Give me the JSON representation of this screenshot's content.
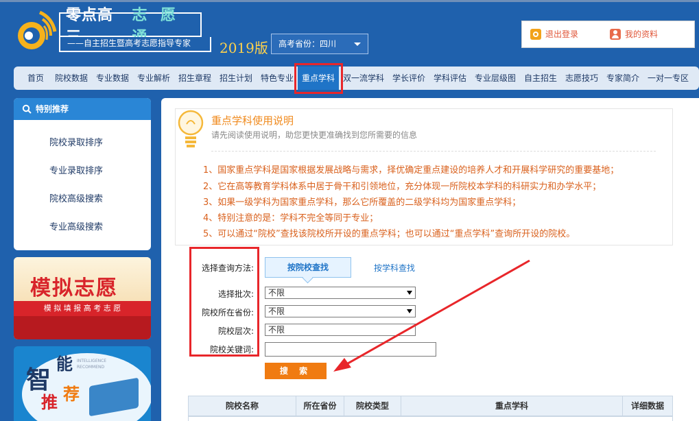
{
  "header": {
    "brand_main": "零点高三",
    "brand_accent": "志 愿 通",
    "brand_sub": "——自主招生暨高考志愿指导专家",
    "year": "2019版",
    "province_select": "高考省份：四川",
    "logout": "退出登录",
    "profile": "我的资料"
  },
  "nav": {
    "items": [
      "首页",
      "院校数据",
      "专业数据",
      "专业解析",
      "招生章程",
      "招生计划",
      "特色专业",
      "重点学科",
      "双一流学科",
      "学长评价",
      "学科评估",
      "专业层级图",
      "自主招生",
      "志愿技巧",
      "专家简介",
      "一对一专区"
    ],
    "active": "重点学科"
  },
  "sidebar": {
    "header": "特别推荐",
    "links": [
      "院校录取排序",
      "专业录取排序",
      "院校高级搜索",
      "专业高级搜索"
    ]
  },
  "banners": {
    "mock_title": "模拟志愿",
    "mock_sub": "模 拟 填 报 高 考 志 愿",
    "smart_title_1": "智",
    "smart_title_2": "能",
    "smart_title_3": "推",
    "smart_title_4": "荐",
    "smart_en_1": "INTELLIGENCE",
    "smart_en_2": "RECOMMEND"
  },
  "info": {
    "title": "重点学科使用说明",
    "subtitle": "请先阅读使用说明，助您更快更准确找到您所需要的信息",
    "rules": [
      "1、国家重点学科是国家根据发展战略与需求，择优确定重点建设的培养人才和开展科学研究的重要基地；",
      "2、它在高等教育学科体系中居于骨干和引领地位，充分体现一所院校本学科的科研实力和办学水平；",
      "3、如果一级学科为国家重点学科，那么它所覆盖的二级学科均为国家重点学科；",
      "4、特别注意的是：学科不完全等同于专业；",
      "5、可以通过“院校”查找该院校所开设的重点学科；也可以通过“重点学科”查询所开设的院校。"
    ]
  },
  "search": {
    "method_label": "选择查询方法:",
    "tab_by_school": "按院校查找",
    "tab_by_subject": "按学科查找",
    "batch_label": "选择批次:",
    "batch_value": "不限",
    "province_label": "院校所在省份:",
    "province_value": "不限",
    "level_label": "院校层次:",
    "level_value": "不限",
    "keyword_label": "院校关键词:",
    "keyword_value": "",
    "submit": "搜 索"
  },
  "table": {
    "columns": [
      "院校名称",
      "所在省份",
      "院校类型",
      "重点学科",
      "详细数据"
    ]
  },
  "colors": {
    "header_bg": "#1f61ad",
    "nav_bg": "#dfe9f5",
    "active_tab": "#1f74c7",
    "highlight_red": "#e8262a",
    "orange_text": "#d9601c",
    "search_button": "#f07b11"
  }
}
